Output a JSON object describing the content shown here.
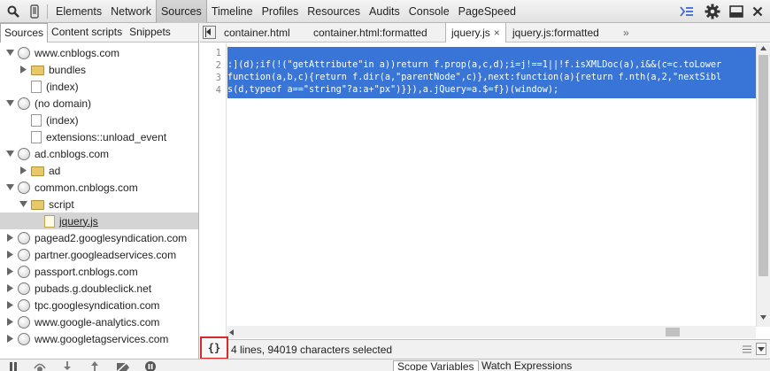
{
  "toolbar": {
    "tabs": [
      {
        "label": "Elements"
      },
      {
        "label": "Network"
      },
      {
        "label": "Sources"
      },
      {
        "label": "Timeline"
      },
      {
        "label": "Profiles"
      },
      {
        "label": "Resources"
      },
      {
        "label": "Audits"
      },
      {
        "label": "Console"
      },
      {
        "label": "PageSpeed"
      }
    ],
    "active_tab": "Sources",
    "icons": [
      "search-icon",
      "device-icon",
      "drawer-icon",
      "gear-icon",
      "dock-icon",
      "close-icon"
    ]
  },
  "navigator": {
    "tabs": [
      {
        "label": "Sources"
      },
      {
        "label": "Content scripts"
      },
      {
        "label": "Snippets"
      }
    ],
    "tree": [
      {
        "label": "www.cnblogs.com",
        "type": "domain",
        "expanded": true
      },
      {
        "label": "bundles",
        "type": "folder",
        "expanded": false
      },
      {
        "label": "(index)",
        "type": "file"
      },
      {
        "label": "(no domain)",
        "type": "domain",
        "expanded": true
      },
      {
        "label": "(index)",
        "type": "file"
      },
      {
        "label": "extensions::unload_event",
        "type": "file"
      },
      {
        "label": "ad.cnblogs.com",
        "type": "domain",
        "expanded": true
      },
      {
        "label": "ad",
        "type": "folder",
        "expanded": false
      },
      {
        "label": "common.cnblogs.com",
        "type": "domain",
        "expanded": true
      },
      {
        "label": "script",
        "type": "folder",
        "expanded": true
      },
      {
        "label": "jquery.js",
        "type": "file-js",
        "selected": true
      },
      {
        "label": "pagead2.googlesyndication.com",
        "type": "domain",
        "expanded": false
      },
      {
        "label": "partner.googleadservices.com",
        "type": "domain",
        "expanded": false
      },
      {
        "label": "passport.cnblogs.com",
        "type": "domain",
        "expanded": false
      },
      {
        "label": "pubads.g.doubleclick.net",
        "type": "domain",
        "expanded": false
      },
      {
        "label": "tpc.googlesyndication.com",
        "type": "domain",
        "expanded": false
      },
      {
        "label": "www.google-analytics.com",
        "type": "domain",
        "expanded": false
      },
      {
        "label": "www.googletagservices.com",
        "type": "domain",
        "expanded": false
      }
    ]
  },
  "editor": {
    "tabs": [
      {
        "label": "container.html"
      },
      {
        "label": "container.html:formatted"
      },
      {
        "label": "jquery.js",
        "close": "×"
      },
      {
        "label": "jquery.js:formatted"
      }
    ],
    "more_tabs": "»",
    "line_numbers": [
      "1",
      "2",
      "3",
      "4"
    ],
    "lines": [
      "",
      ":](d);if(!(\"getAttribute\"in a))return f.prop(a,c,d);i=j!==1||!f.isXMLDoc(a),i&&(c=c.toLower",
      "function(a,b,c){return f.dir(a,\"parentNode\",c)},next:function(a){return f.nth(a,2,\"nextSibl",
      "s(d,typeof a==\"string\"?a:a+\"px\")}}),a.jQuery=a.$=f})(window);"
    ]
  },
  "status": {
    "pretty_print_label": "{}",
    "selection_text": "4 lines, 94019 characters selected"
  },
  "bottom": {
    "tabs": [
      {
        "label": "Scope Variables"
      },
      {
        "label": "Watch Expressions"
      }
    ]
  },
  "colors": {
    "selection": "#3875d7",
    "highlight_box": "#d42a2a"
  }
}
